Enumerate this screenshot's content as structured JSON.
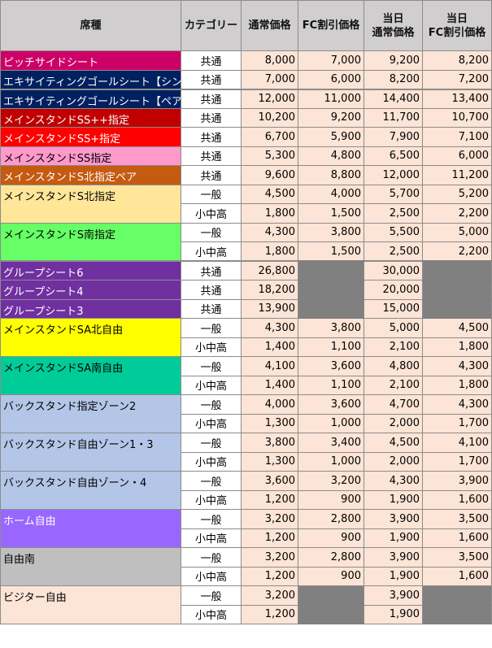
{
  "header": {
    "seat": "席種",
    "category": "カテゴリー",
    "normal": "通常価格",
    "fc": "FC割引価格",
    "day_line1": "当日",
    "day_normal_line2": "通常価格",
    "day_fc_line2": "FC割引価格"
  },
  "colors": {
    "price_bg": "#fce4d6",
    "unavailable": "#808080",
    "header_bg": "#d0cece"
  },
  "groups": [
    {
      "name": "ピッチサイドシート",
      "bg": "#cc0066",
      "fg": "#ffffff",
      "rows": [
        {
          "cat": "共通",
          "p": [
            "8,000",
            "7,000",
            "9,200",
            "8,200"
          ]
        }
      ]
    },
    {
      "name": "エキサイティングゴールシート【シングル】",
      "bg": "#002060",
      "fg": "#ffffff",
      "rows": [
        {
          "cat": "共通",
          "p": [
            "7,000",
            "6,000",
            "8,200",
            "7,200"
          ]
        }
      ]
    },
    {
      "name": "エキサイティングゴールシート【ペア】",
      "bg": "#002060",
      "fg": "#ffffff",
      "sep": true,
      "rows": [
        {
          "cat": "共通",
          "p": [
            "12,000",
            "11,000",
            "14,400",
            "13,400"
          ]
        }
      ]
    },
    {
      "name": "メインスタンドSS++指定",
      "bg": "#c00000",
      "fg": "#ffffff",
      "rows": [
        {
          "cat": "共通",
          "p": [
            "10,200",
            "9,200",
            "11,700",
            "10,700"
          ]
        }
      ]
    },
    {
      "name": "メインスタンドSS+指定",
      "bg": "#ff0000",
      "fg": "#ffffff",
      "rows": [
        {
          "cat": "共通",
          "p": [
            "6,700",
            "5,900",
            "7,900",
            "7,100"
          ]
        }
      ]
    },
    {
      "name": "メインスタンドSS指定",
      "bg": "#ff99cc",
      "fg": "#000000",
      "rows": [
        {
          "cat": "共通",
          "p": [
            "5,300",
            "4,800",
            "6,500",
            "6,000"
          ]
        }
      ]
    },
    {
      "name": "メインスタンドS北指定ペア",
      "bg": "#c55a11",
      "fg": "#ffffff",
      "rows": [
        {
          "cat": "共通",
          "p": [
            "9,600",
            "8,800",
            "12,000",
            "11,200"
          ]
        }
      ]
    },
    {
      "name": "メインスタンドS北指定",
      "bg": "#ffe699",
      "fg": "#000000",
      "rows": [
        {
          "cat": "一般",
          "p": [
            "4,500",
            "4,000",
            "5,700",
            "5,200"
          ]
        },
        {
          "cat": "小中高",
          "p": [
            "1,800",
            "1,500",
            "2,500",
            "2,200"
          ]
        }
      ]
    },
    {
      "name": "メインスタンドS南指定",
      "bg": "#66ff66",
      "fg": "#000000",
      "rows": [
        {
          "cat": "一般",
          "p": [
            "4,300",
            "3,800",
            "5,500",
            "5,000"
          ]
        },
        {
          "cat": "小中高",
          "p": [
            "1,800",
            "1,500",
            "2,500",
            "2,200"
          ]
        }
      ]
    },
    {
      "name": "グループシート6",
      "bg": "#7030a0",
      "fg": "#ffffff",
      "sep": true,
      "rows": [
        {
          "cat": "共通",
          "p": [
            "26,800",
            null,
            "30,000",
            null
          ]
        }
      ]
    },
    {
      "name": "グループシート4",
      "bg": "#7030a0",
      "fg": "#ffffff",
      "rows": [
        {
          "cat": "共通",
          "p": [
            "18,200",
            null,
            "20,000",
            null
          ]
        }
      ]
    },
    {
      "name": "グループシート3",
      "bg": "#7030a0",
      "fg": "#ffffff",
      "rows": [
        {
          "cat": "共通",
          "p": [
            "13,900",
            null,
            "15,000",
            null
          ]
        }
      ]
    },
    {
      "name": "メインスタンドSA北自由",
      "bg": "#ffff00",
      "fg": "#000000",
      "rows": [
        {
          "cat": "一般",
          "p": [
            "4,300",
            "3,800",
            "5,000",
            "4,500"
          ]
        },
        {
          "cat": "小中高",
          "p": [
            "1,400",
            "1,100",
            "2,100",
            "1,800"
          ]
        }
      ]
    },
    {
      "name": "メインスタンドSA南自由",
      "bg": "#00cc99",
      "fg": "#000000",
      "rows": [
        {
          "cat": "一般",
          "p": [
            "4,100",
            "3,600",
            "4,800",
            "4,300"
          ]
        },
        {
          "cat": "小中高",
          "p": [
            "1,400",
            "1,100",
            "2,100",
            "1,800"
          ]
        }
      ]
    },
    {
      "name": "バックスタンド指定ゾーン2",
      "bg": "#b4c6e7",
      "fg": "#000000",
      "rows": [
        {
          "cat": "一般",
          "p": [
            "4,000",
            "3,600",
            "4,700",
            "4,300"
          ]
        },
        {
          "cat": "小中高",
          "p": [
            "1,300",
            "1,000",
            "2,000",
            "1,700"
          ]
        }
      ]
    },
    {
      "name": "バックスタンド自由ゾーン1・3",
      "bg": "#b4c6e7",
      "fg": "#000000",
      "rows": [
        {
          "cat": "一般",
          "p": [
            "3,800",
            "3,400",
            "4,500",
            "4,100"
          ]
        },
        {
          "cat": "小中高",
          "p": [
            "1,300",
            "1,000",
            "2,000",
            "1,700"
          ]
        }
      ]
    },
    {
      "name": "バックスタンド自由ゾーン・4",
      "bg": "#b4c6e7",
      "fg": "#000000",
      "rows": [
        {
          "cat": "一般",
          "p": [
            "3,600",
            "3,200",
            "4,300",
            "3,900"
          ]
        },
        {
          "cat": "小中高",
          "p": [
            "1,200",
            "900",
            "1,900",
            "1,600"
          ]
        }
      ]
    },
    {
      "name": "ホーム自由",
      "bg": "#9966ff",
      "fg": "#ffffff",
      "rows": [
        {
          "cat": "一般",
          "p": [
            "3,200",
            "2,800",
            "3,900",
            "3,500"
          ]
        },
        {
          "cat": "小中高",
          "p": [
            "1,200",
            "900",
            "1,900",
            "1,600"
          ]
        }
      ]
    },
    {
      "name": "自由南",
      "bg": "#bfbfbf",
      "fg": "#000000",
      "rows": [
        {
          "cat": "一般",
          "p": [
            "3,200",
            "2,800",
            "3,900",
            "3,500"
          ]
        },
        {
          "cat": "小中高",
          "p": [
            "1,200",
            "900",
            "1,900",
            "1,600"
          ]
        }
      ]
    },
    {
      "name": "ビジター自由",
      "bg": "#fce4d6",
      "fg": "#000000",
      "rows": [
        {
          "cat": "一般",
          "p": [
            "3,200",
            null,
            "3,900",
            null
          ]
        },
        {
          "cat": "小中高",
          "p": [
            "1,200",
            null,
            "1,900",
            null
          ]
        }
      ]
    }
  ]
}
